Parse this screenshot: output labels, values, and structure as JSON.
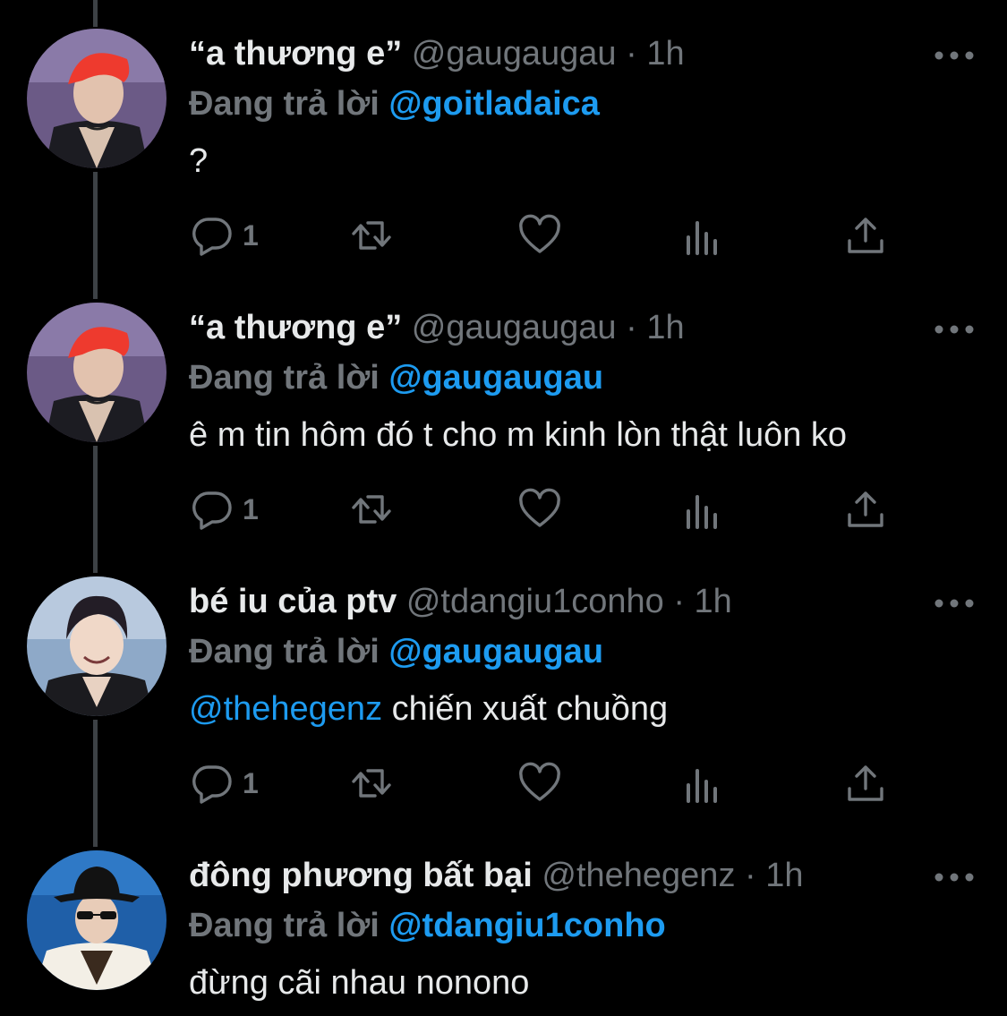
{
  "colors": {
    "background": "#000000",
    "name": "#e7e9ea",
    "muted": "#71767b",
    "link": "#1d9bf0",
    "thread_line": "#3d4145"
  },
  "labels": {
    "replying_to": "Đang trả lời",
    "separator": "·"
  },
  "tweets": [
    {
      "name": "“a thương e”",
      "handle": "@gaugaugau",
      "time": "1h",
      "reply_to": "@goitladaica",
      "mention": "",
      "text": "?",
      "reply_count": "1",
      "avatar_icon": "red-hair-avatar"
    },
    {
      "name": "“a thương e”",
      "handle": "@gaugaugau",
      "time": "1h",
      "reply_to": "@gaugaugau",
      "mention": "",
      "text": "ê m tin hôm đó t cho m kinh lòn thật luôn ko",
      "reply_count": "1",
      "avatar_icon": "red-hair-avatar"
    },
    {
      "name": "bé iu của ptv",
      "handle": "@tdangiu1conho",
      "time": "1h",
      "reply_to": "@gaugaugau",
      "mention": "@thehegenz",
      "text": " chiến xuất chuồng",
      "reply_count": "1",
      "avatar_icon": "smiling-person-avatar"
    },
    {
      "name": "đông phương bất bại",
      "handle": "@thehegenz",
      "time": "1h",
      "reply_to": "@tdangiu1conho",
      "mention": "",
      "text": "đừng cãi nhau nonono",
      "reply_count": "",
      "avatar_icon": "hat-sunglasses-avatar"
    }
  ]
}
